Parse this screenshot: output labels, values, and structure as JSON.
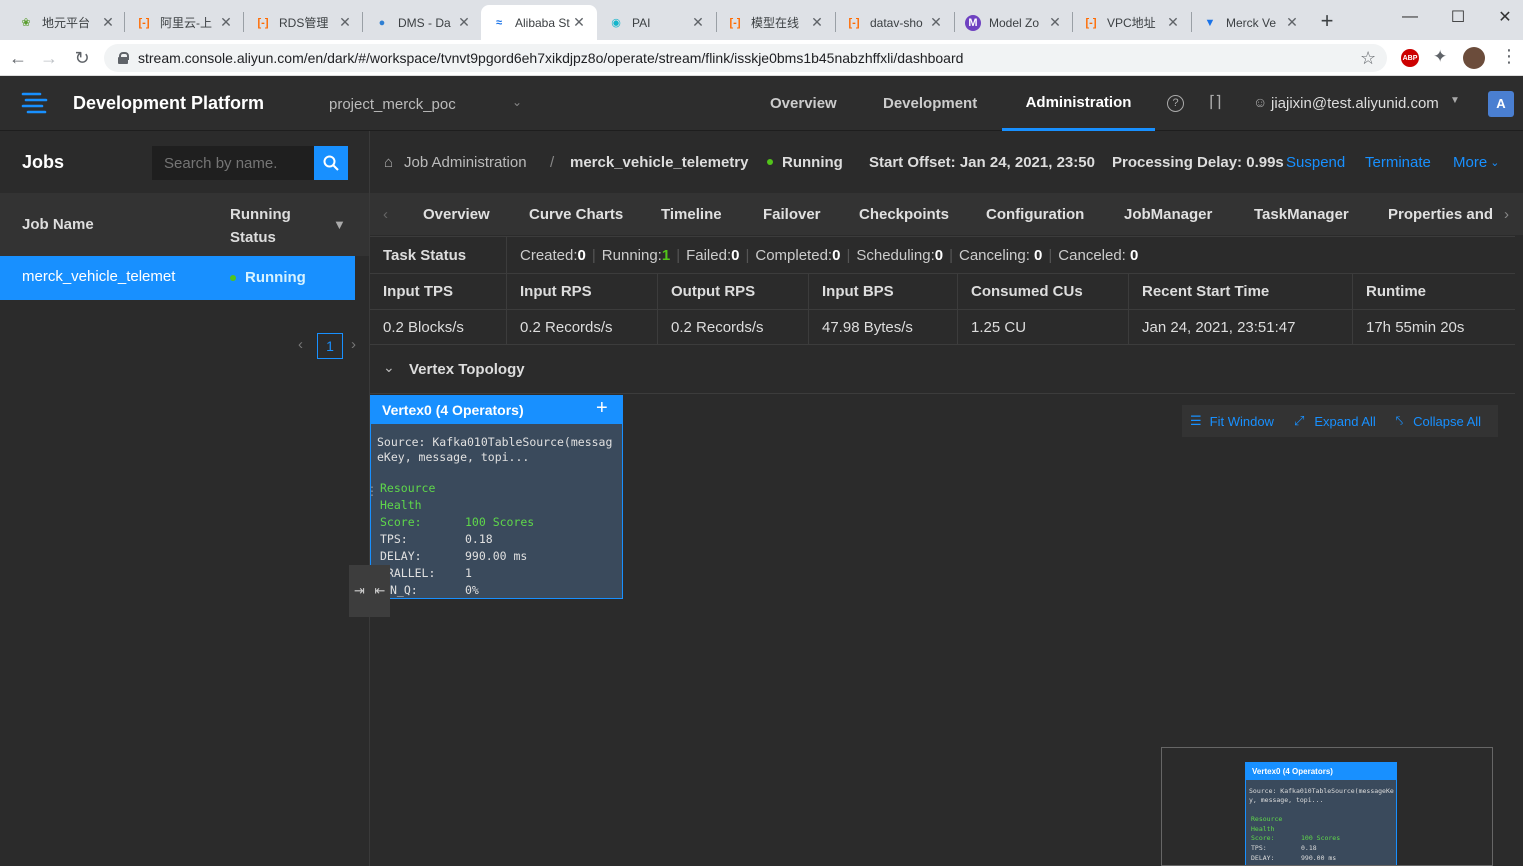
{
  "browser": {
    "tabs": [
      {
        "title": "地元平台",
        "icon": "leaf-icon"
      },
      {
        "title": "阿里云-上",
        "icon": "aliyun-icon"
      },
      {
        "title": "RDS管理",
        "icon": "aliyun-icon"
      },
      {
        "title": "DMS - Da",
        "icon": "dms-icon"
      },
      {
        "title": "Alibaba St",
        "icon": "stream-icon"
      },
      {
        "title": "PAI",
        "icon": "pai-icon"
      },
      {
        "title": "模型在线",
        "icon": "aliyun-icon"
      },
      {
        "title": "datav-sho",
        "icon": "aliyun-icon"
      },
      {
        "title": "Model Zo",
        "icon": "m-icon"
      },
      {
        "title": "VPC地址",
        "icon": "aliyun-icon"
      },
      {
        "title": "Merck Ve",
        "icon": "v-icon"
      }
    ],
    "url": "stream.console.aliyun.com/en/dark/#/workspace/tvnvt9pgord6eh7xikdjpz8o/operate/stream/flink/isskje0bms1b45nabzhffxli/dashboard"
  },
  "header": {
    "app_title": "Development Platform",
    "project": "project_merck_poc",
    "nav": [
      "Overview",
      "Development",
      "Administration"
    ],
    "user": "jiajixin@test.aliyunid.com"
  },
  "jobs_panel": {
    "title": "Jobs",
    "search_placeholder": "Search by name.",
    "col_name": "Job Name",
    "col_status": "Running\nStatus",
    "rows": [
      {
        "name": "merck_vehicle_telemet",
        "status": "Running"
      }
    ],
    "page": "1"
  },
  "breadcrumb": {
    "root": "Job Administration",
    "sep": "/",
    "job": "merck_vehicle_telemetry",
    "status": "Running",
    "start_offset": "Start Offset: Jan 24, 2021, 23:50",
    "delay": "Processing Delay: 0.99s",
    "suspend": "Suspend",
    "terminate": "Terminate",
    "more": "More"
  },
  "subtabs": [
    "Overview",
    "Curve Charts",
    "Timeline",
    "Failover",
    "Checkpoints",
    "Configuration",
    "JobManager",
    "TaskManager",
    "Properties and"
  ],
  "task_status": {
    "label": "Task Status",
    "items": [
      {
        "label": "Created:",
        "value": "0"
      },
      {
        "label": "Running:",
        "value": "1"
      },
      {
        "label": "Failed:",
        "value": "0"
      },
      {
        "label": "Completed:",
        "value": "0"
      },
      {
        "label": "Scheduling:",
        "value": "0"
      },
      {
        "label": "Canceling: ",
        "value": "0"
      },
      {
        "label": "Canceled: ",
        "value": "0"
      }
    ]
  },
  "metrics": {
    "headers": [
      "Input TPS",
      "Input RPS",
      "Output RPS",
      "Input BPS",
      "Consumed CUs",
      "Recent Start Time",
      "Runtime"
    ],
    "values": [
      "0.2 Blocks/s",
      "0.2 Records/s",
      "0.2 Records/s",
      "47.98 Bytes/s",
      "1.25 CU",
      "Jan 24, 2021, 23:51:47",
      "17h 55min 20s"
    ]
  },
  "topology": {
    "title": "Vertex Topology",
    "fit": "Fit Window",
    "expand": "Expand All",
    "collapse": "Collapse All",
    "vertex": {
      "title": "Vertex0 (4 Operators)",
      "source": "Source: Kafka010TableSource(messageKey, message, topi...",
      "health_1": "Resource",
      "health_2": "Health",
      "score_label": "Score:",
      "score_value": "100 Scores",
      "tps_label": "TPS:",
      "tps_value": "0.18",
      "delay_label": "DELAY:",
      "delay_value": "990.00 ms",
      "parallel_label": "ARALLEL:",
      "parallel_value": "1",
      "inq_label": "N_Q:",
      "inq_value": "0%"
    }
  },
  "colors": {
    "accent": "#1890ff",
    "running": "#52c41a",
    "vertex_bg": "#3a4a5c"
  }
}
